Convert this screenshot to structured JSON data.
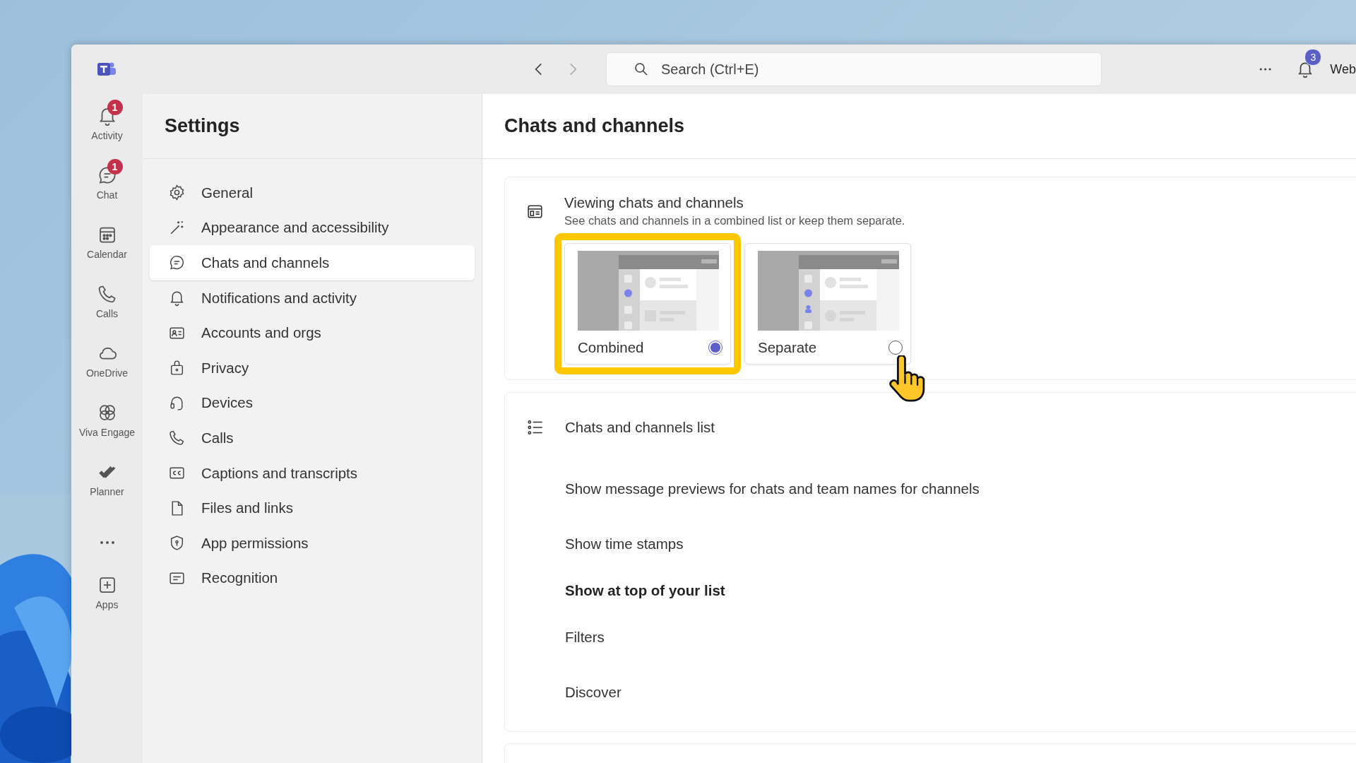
{
  "title_bar": {
    "search": {
      "placeholder": "Search (Ctrl+E)"
    },
    "notification_count": "3",
    "user_name": "Web"
  },
  "app_rail": [
    {
      "label": "Activity",
      "badge": "1"
    },
    {
      "label": "Chat",
      "badge": "1"
    },
    {
      "label": "Calendar"
    },
    {
      "label": "Calls"
    },
    {
      "label": "OneDrive"
    },
    {
      "label": "Viva Engage"
    },
    {
      "label": "Planner"
    },
    {
      "label": "Apps"
    }
  ],
  "settings": {
    "title": "Settings",
    "items": [
      {
        "label": "General",
        "selected": false
      },
      {
        "label": "Appearance and accessibility",
        "selected": false
      },
      {
        "label": "Chats and channels",
        "selected": true
      },
      {
        "label": "Notifications and activity",
        "selected": false
      },
      {
        "label": "Accounts and orgs",
        "selected": false
      },
      {
        "label": "Privacy",
        "selected": false
      },
      {
        "label": "Devices",
        "selected": false
      },
      {
        "label": "Calls",
        "selected": false
      },
      {
        "label": "Captions and transcripts",
        "selected": false
      },
      {
        "label": "Files and links",
        "selected": false
      },
      {
        "label": "App permissions",
        "selected": false
      },
      {
        "label": "Recognition",
        "selected": false
      }
    ]
  },
  "content": {
    "title": "Chats and channels",
    "viewing": {
      "title": "Viewing chats and channels",
      "description": "See chats and channels in a combined list or keep them separate.",
      "options": [
        {
          "label": "Combined",
          "kind": "combined",
          "selected": true,
          "highlighted": true
        },
        {
          "label": "Separate",
          "kind": "separate",
          "selected": false,
          "highlighted": false
        }
      ]
    },
    "list_section": {
      "title": "Chats and channels list",
      "items": [
        {
          "label": "Show message previews for chats and team names for channels",
          "kind": "setting"
        },
        {
          "label": "Show time stamps",
          "kind": "setting"
        },
        {
          "label": "Show at top of your list",
          "kind": "heading"
        },
        {
          "label": "Filters",
          "kind": "setting"
        },
        {
          "label": "Discover",
          "kind": "setting"
        }
      ]
    }
  }
}
